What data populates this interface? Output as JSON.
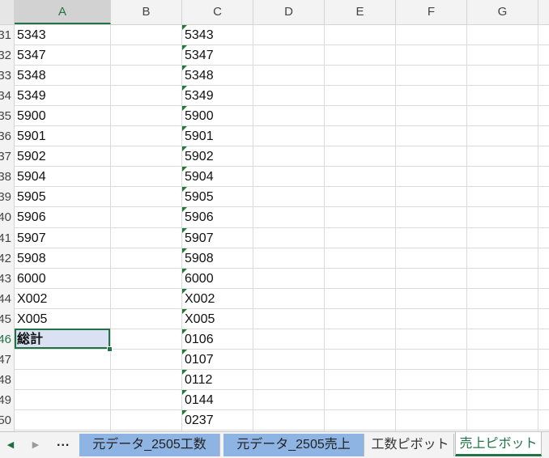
{
  "columns": [
    "A",
    "B",
    "C",
    "D",
    "E",
    "F",
    "G"
  ],
  "selected_column": "A",
  "rows": [
    {
      "num": "31",
      "a": "5343",
      "c": "5343"
    },
    {
      "num": "32",
      "a": "5347",
      "c": "5347"
    },
    {
      "num": "33",
      "a": "5348",
      "c": "5348"
    },
    {
      "num": "34",
      "a": "5349",
      "c": "5349"
    },
    {
      "num": "35",
      "a": "5900",
      "c": "5900"
    },
    {
      "num": "36",
      "a": "5901",
      "c": "5901"
    },
    {
      "num": "37",
      "a": "5902",
      "c": "5902"
    },
    {
      "num": "38",
      "a": "5904",
      "c": "5904"
    },
    {
      "num": "39",
      "a": "5905",
      "c": "5905"
    },
    {
      "num": "40",
      "a": "5906",
      "c": "5906"
    },
    {
      "num": "41",
      "a": "5907",
      "c": "5907"
    },
    {
      "num": "42",
      "a": "5908",
      "c": "5908"
    },
    {
      "num": "43",
      "a": "6000",
      "c": "6000"
    },
    {
      "num": "44",
      "a": "X002",
      "c": "X002"
    },
    {
      "num": "45",
      "a": "X005",
      "c": "X005"
    },
    {
      "num": "46",
      "a": "総計",
      "c": "0106",
      "selected": true
    },
    {
      "num": "47",
      "a": "",
      "c": "0107"
    },
    {
      "num": "48",
      "a": "",
      "c": "0112"
    },
    {
      "num": "49",
      "a": "",
      "c": "0144"
    },
    {
      "num": "50",
      "a": "",
      "c": "0237"
    }
  ],
  "sheet_tabs": [
    {
      "label": "元データ_2505工数",
      "style": "blue"
    },
    {
      "label": "元データ_2505売上",
      "style": "blue"
    },
    {
      "label": "工数ピボット",
      "style": "normal"
    },
    {
      "label": "売上ピボット",
      "style": "active"
    }
  ],
  "tab_nav": {
    "prev_icon": "◀",
    "next_icon": "▶",
    "more_label": "..."
  },
  "colors": {
    "accent": "#217346",
    "tab_blue": "#8db4e2",
    "selected_fill": "#d9e1f2",
    "error_triangle": "#1e7a34"
  }
}
